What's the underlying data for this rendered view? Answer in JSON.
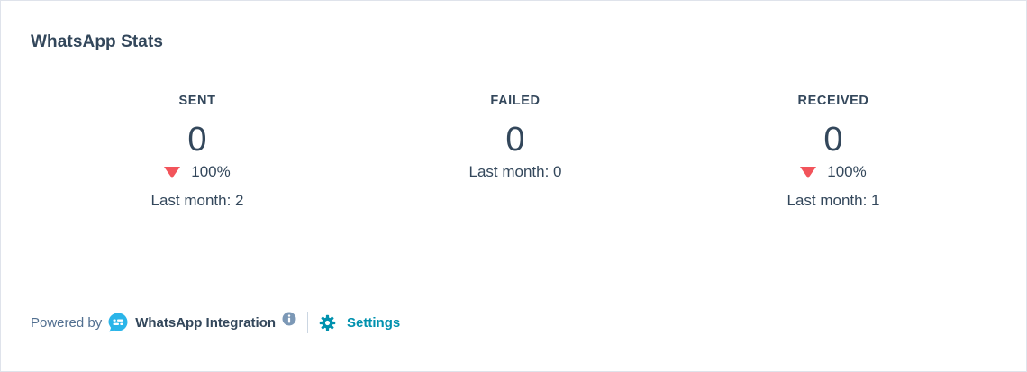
{
  "card": {
    "title": "WhatsApp Stats"
  },
  "stats": [
    {
      "label": "SENT",
      "value": "0",
      "change": "100%",
      "change_direction": "down",
      "last_month": "Last month: 2"
    },
    {
      "label": "FAILED",
      "value": "0",
      "change": "",
      "change_direction": "none",
      "last_month": "Last month: 0"
    },
    {
      "label": "RECEIVED",
      "value": "0",
      "change": "100%",
      "change_direction": "down",
      "last_month": "Last month: 1"
    }
  ],
  "footer": {
    "powered_by": "Powered by",
    "integration_name": "WhatsApp Integration",
    "settings_label": "Settings",
    "icons": [
      "whatsapp-integration-logo-icon",
      "info-icon",
      "gear-icon"
    ]
  },
  "colors": {
    "decrease": "#f2545b",
    "link": "#0091ae",
    "text": "#33475b",
    "brand": "#2bb5e9"
  }
}
